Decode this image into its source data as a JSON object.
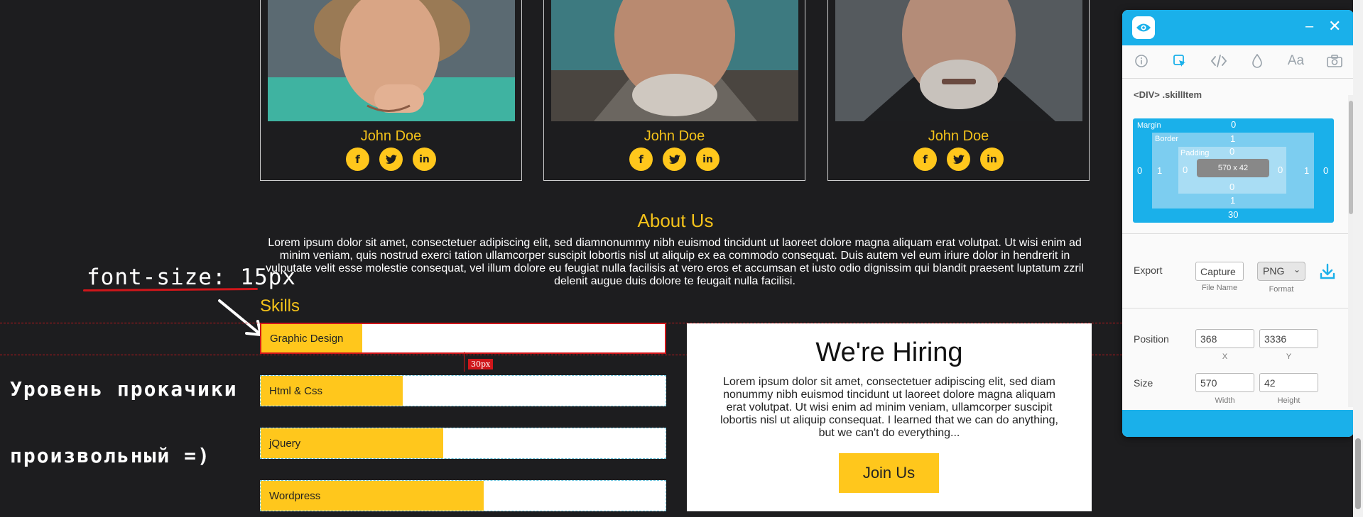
{
  "team": [
    {
      "name": "John Doe"
    },
    {
      "name": "John Doe"
    },
    {
      "name": "John Doe"
    }
  ],
  "social_icons": [
    "facebook-icon",
    "twitter-icon",
    "linkedin-icon"
  ],
  "about": {
    "title": "About Us",
    "text": "Lorem ipsum dolor sit amet, consectetuer adipiscing elit, sed diamnonummy nibh euismod tincidunt ut laoreet dolore magna aliquam erat volutpat. Ut wisi enim ad minim veniam, quis nostrud exerci tation ullamcorper suscipit lobortis nisl ut aliquip ex ea commodo consequat. Duis autem vel eum iriure dolor in hendrerit in vulputate velit esse molestie consequat, vel illum dolore eu feugiat nulla facilisis at vero eros et accumsan et iusto odio dignissim qui blandit praesent luptatum zzril delenit augue duis dolore te feugait nulla facilisi."
  },
  "skills": {
    "title": "Skills",
    "items": [
      {
        "label": "Graphic Design",
        "level": 0.25
      },
      {
        "label": "Html & Css",
        "level": 0.35
      },
      {
        "label": "jQuery",
        "level": 0.45
      },
      {
        "label": "Wordpress",
        "level": 0.55
      }
    ],
    "spacing_badge": "30px"
  },
  "hiring": {
    "title": "We're Hiring",
    "text": "Lorem ipsum dolor sit amet, consectetuer adipiscing elit, sed diam nonummy nibh euismod tincidunt ut laoreet dolore magna aliquam erat volutpat. Ut wisi enim ad minim veniam, ullamcorper suscipit lobortis nisl ut aliquip consequat. I learned that we can do anything, but we can't do everything...",
    "button": "Join Us"
  },
  "annotations": {
    "font_size": "font-size: 15px",
    "ru_line1": "Уровень прокачики",
    "ru_line2": "произвольный =)"
  },
  "inspector": {
    "element": "<DIV> .skillItem",
    "tabs": [
      "info-icon",
      "inspect-icon",
      "code-icon",
      "color-drop-icon",
      "typography-icon",
      "camera-icon"
    ],
    "box_model": {
      "margin_label": "Margin",
      "border_label": "Border",
      "padding_label": "Padding",
      "content": "570 x 42",
      "margin": {
        "top": "0",
        "right": "0",
        "bottom": "30",
        "left": "0"
      },
      "border": {
        "top": "1",
        "right": "1",
        "bottom": "1",
        "left": "1"
      },
      "padding": {
        "top": "0",
        "right": "0",
        "bottom": "0",
        "left": "0"
      }
    },
    "export": {
      "label": "Export",
      "file_name": "Capture",
      "file_name_label": "File Name",
      "format": "PNG",
      "format_label": "Format"
    },
    "position": {
      "label": "Position",
      "x": "368",
      "y": "3336",
      "x_label": "X",
      "y_label": "Y"
    },
    "size": {
      "label": "Size",
      "width": "570",
      "height": "42",
      "width_label": "Width",
      "height_label": "Height"
    },
    "colors": {
      "accent": "#1ab0ea"
    }
  },
  "colors": {
    "page_bg": "#1d1d1f",
    "brand_yellow": "#ffc71c",
    "title_yellow": "#f4c21a",
    "annotation_red": "#d0161a"
  }
}
